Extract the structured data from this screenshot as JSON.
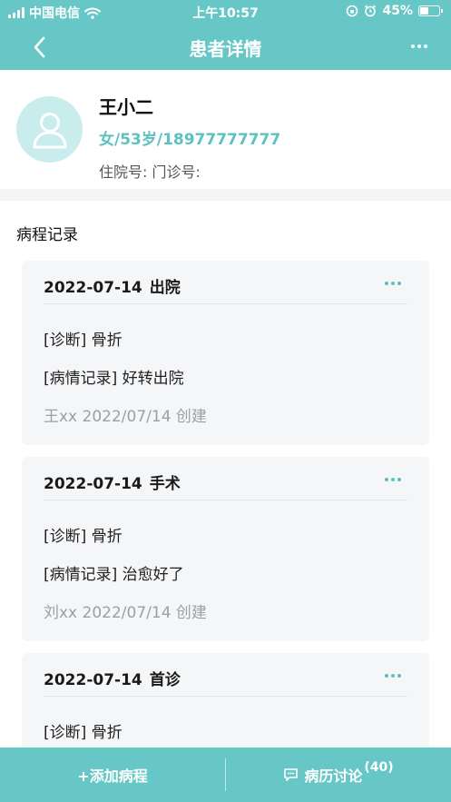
{
  "status_bar": {
    "carrier": "中国电信",
    "time": "上午10:57",
    "battery_percent": "45%",
    "battery_level": 0.45
  },
  "nav": {
    "title": "患者详情"
  },
  "patient": {
    "name": "王小二",
    "info": "女/53岁/18977777777",
    "ids": "住院号:  门诊号:"
  },
  "records": {
    "section_title": "病程记录",
    "items": [
      {
        "date": "2022-07-14",
        "type": "出院",
        "diagnosis": "[诊断] 骨折",
        "note": "[病情记录] 好转出院",
        "meta": "王xx  2022/07/14  创建"
      },
      {
        "date": "2022-07-14",
        "type": "手术",
        "diagnosis": "[诊断] 骨折",
        "note": "[病情记录] 治愈好了",
        "meta": "刘xx  2022/07/14  创建"
      },
      {
        "date": "2022-07-14",
        "type": "首诊",
        "diagnosis": "[诊断] 骨折",
        "note": "",
        "meta": ""
      }
    ]
  },
  "bottom_bar": {
    "add_label": "+添加病程",
    "discuss_label": "病历讨论",
    "discuss_count": "(40)"
  },
  "colors": {
    "accent": "#66c7c6",
    "accent_text": "#5cc1c0"
  }
}
